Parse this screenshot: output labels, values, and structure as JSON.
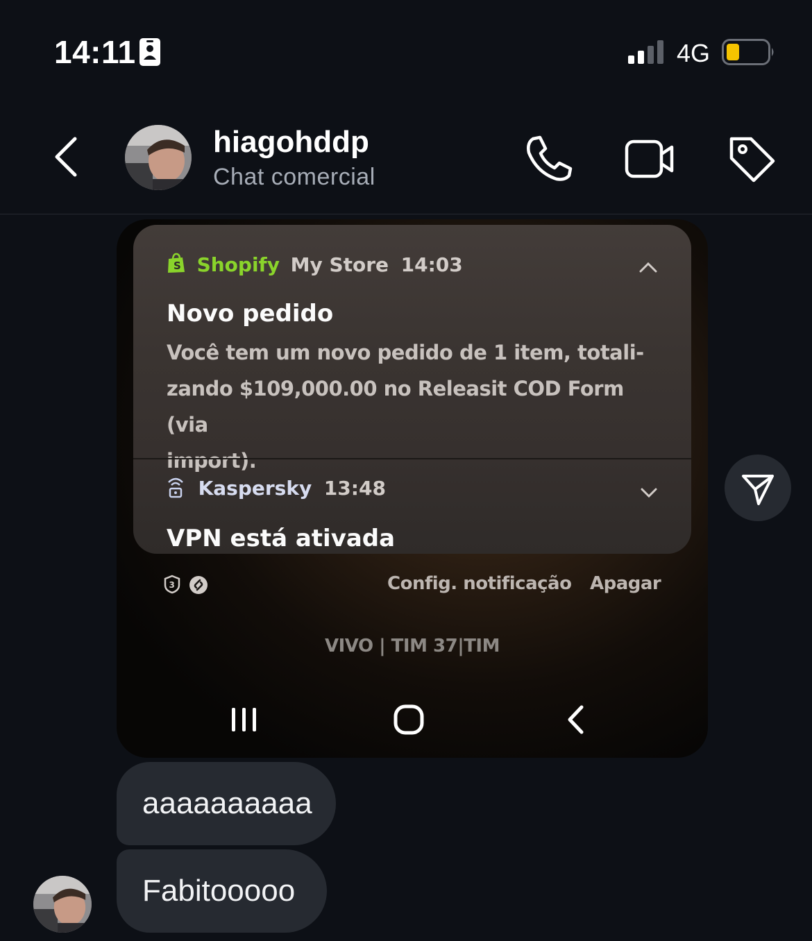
{
  "status_bar": {
    "time": "14:11",
    "network": "4G",
    "battery_color": "#f5c400",
    "icons": [
      "id-card-icon",
      "signal-icon",
      "battery-icon"
    ]
  },
  "header": {
    "contact_name": "hiagohddp",
    "subtitle": "Chat comercial",
    "icons": [
      "back-icon",
      "phone-icon",
      "video-icon",
      "tag-icon"
    ]
  },
  "shared_screenshot": {
    "notifications": [
      {
        "app": "Shopify",
        "app_color": "#8ad42b",
        "store": "My Store",
        "time": "14:03",
        "title": "Novo pedido",
        "body_lines": [
          "Você tem um novo pedido de 1 item, totali-",
          "zando $109,000.00 no Releasit COD Form (via",
          "import)."
        ]
      },
      {
        "app": "Kaspersky",
        "app_color": "#c9d2ee",
        "time": "13:48",
        "title": "VPN está ativada"
      }
    ],
    "actions": {
      "settings": "Config. notificação",
      "clear": "Apagar"
    },
    "carrier": "VIVO | TIM 37|TIM"
  },
  "messages": [
    {
      "text": "aaaaaaaaaa"
    },
    {
      "text": "Fabitooooo"
    }
  ],
  "colors": {
    "background": "#0d1016",
    "bubble": "#262a31"
  }
}
